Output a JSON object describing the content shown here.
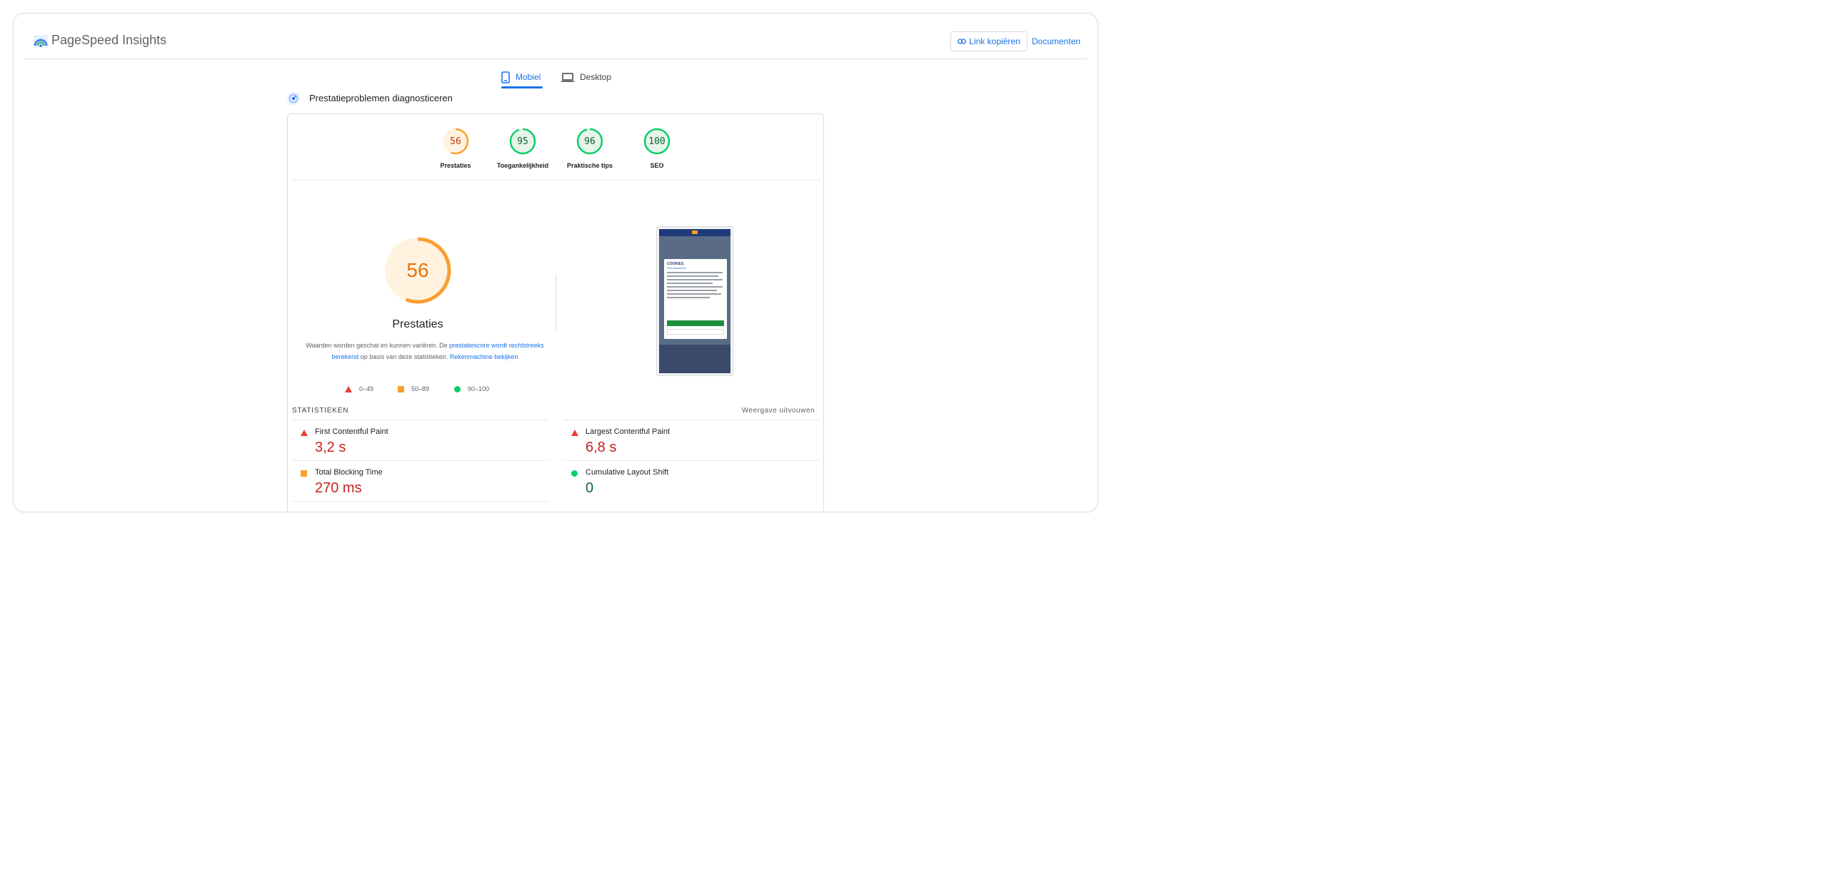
{
  "header": {
    "app_title": "PageSpeed Insights",
    "copy_link_label": "Link kopiëren",
    "docs_label": "Documenten"
  },
  "tabs": [
    {
      "label": "Mobiel",
      "active": true,
      "icon": "phone-icon"
    },
    {
      "label": "Desktop",
      "active": false,
      "icon": "laptop-icon"
    }
  ],
  "diagnostics_title": "Prestatieproblemen diagnosticeren",
  "scores": [
    {
      "label": "Prestaties",
      "value": "56",
      "status": "average",
      "fraction": 0.56
    },
    {
      "label": "Toegankelijkheid",
      "value": "95",
      "status": "pass",
      "fraction": 0.95
    },
    {
      "label": "Praktische tips",
      "value": "96",
      "status": "pass",
      "fraction": 0.96
    },
    {
      "label": "SEO",
      "value": "100",
      "status": "pass",
      "fraction": 1.0
    }
  ],
  "performance": {
    "score": "56",
    "fraction": 0.56,
    "title": "Prestaties",
    "desc_part1": "Waarden worden geschat en kunnen variëren. De ",
    "desc_link1": "prestatiescore wordt rechtstreeks berekend",
    "desc_part2": " op basis van deze statistieken. ",
    "desc_link2": "Rekenmachine bekijken"
  },
  "legend": [
    {
      "label": "0–49",
      "shape": "triangle",
      "color": "#eb3b36"
    },
    {
      "label": "50–89",
      "shape": "square",
      "color": "#fa9f2e"
    },
    {
      "label": "90–100",
      "shape": "circle",
      "color": "#0cce6b"
    }
  ],
  "screenshot": {
    "dialog_title": "COOKIES.",
    "dialog_subtitle": "Gebruiksbeleid"
  },
  "metrics_section": {
    "title": "STATISTIEKEN",
    "expand_label": "Weergave uitvouwen",
    "items": [
      {
        "name": "First Contentful Paint",
        "value": "3,2 s",
        "status": "fail"
      },
      {
        "name": "Largest Contentful Paint",
        "value": "6,8 s",
        "status": "fail"
      },
      {
        "name": "Total Blocking Time",
        "value": "270 ms",
        "status": "average"
      },
      {
        "name": "Cumulative Layout Shift",
        "value": "0",
        "status": "pass"
      }
    ]
  },
  "colors": {
    "fail": "#c5221f",
    "average": "#e8710a",
    "pass": "#0d652d",
    "accent": "#1a73e8"
  }
}
